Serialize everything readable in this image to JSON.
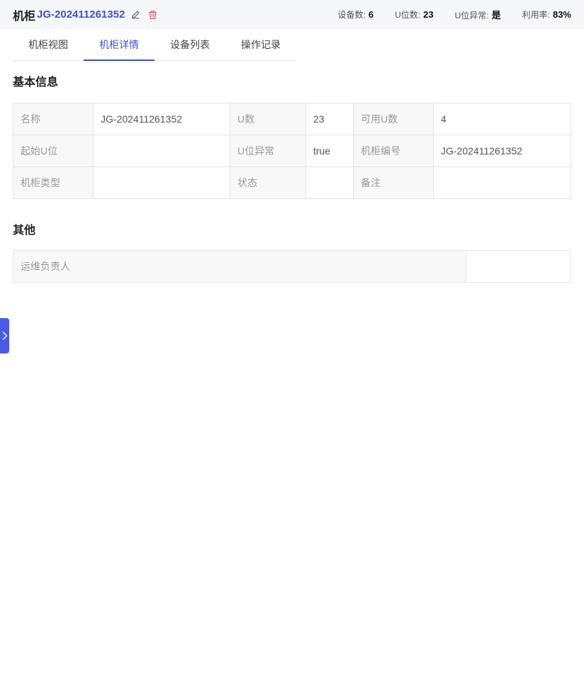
{
  "header": {
    "title_prefix": "机柜",
    "cabinet_code": "JG-202411261352",
    "stats": [
      {
        "label": "设备数:",
        "value": "6"
      },
      {
        "label": "U位数:",
        "value": "23"
      },
      {
        "label": "U位异常:",
        "value": "是"
      },
      {
        "label": "利用率:",
        "value": "83%"
      }
    ]
  },
  "tabs": [
    {
      "label": "机柜视图",
      "active": false
    },
    {
      "label": "机柜详情",
      "active": true
    },
    {
      "label": "设备列表",
      "active": false
    },
    {
      "label": "操作记录",
      "active": false
    }
  ],
  "basic_info": {
    "title": "基本信息",
    "rows": [
      [
        {
          "label": "名称",
          "value": "JG-202411261352"
        },
        {
          "label": "U数",
          "value": "23"
        },
        {
          "label": "可用U数",
          "value": "4"
        }
      ],
      [
        {
          "label": "起始U位",
          "value": ""
        },
        {
          "label": "U位异常",
          "value": "true"
        },
        {
          "label": "机柜编号",
          "value": "JG-202411261352"
        }
      ],
      [
        {
          "label": "机柜类型",
          "value": ""
        },
        {
          "label": "状态",
          "value": ""
        },
        {
          "label": "备注",
          "value": ""
        }
      ]
    ]
  },
  "other_info": {
    "title": "其他",
    "rows": [
      [
        {
          "label": "运维负责人",
          "value": ""
        }
      ]
    ]
  },
  "colors": {
    "accent": "#3f51d8",
    "delete": "#e5484d",
    "side_tab": "#4a5ae8"
  },
  "icons": {
    "edit": "pencil-icon",
    "delete": "trash-icon",
    "side_tab": "chevron-right-icon"
  }
}
